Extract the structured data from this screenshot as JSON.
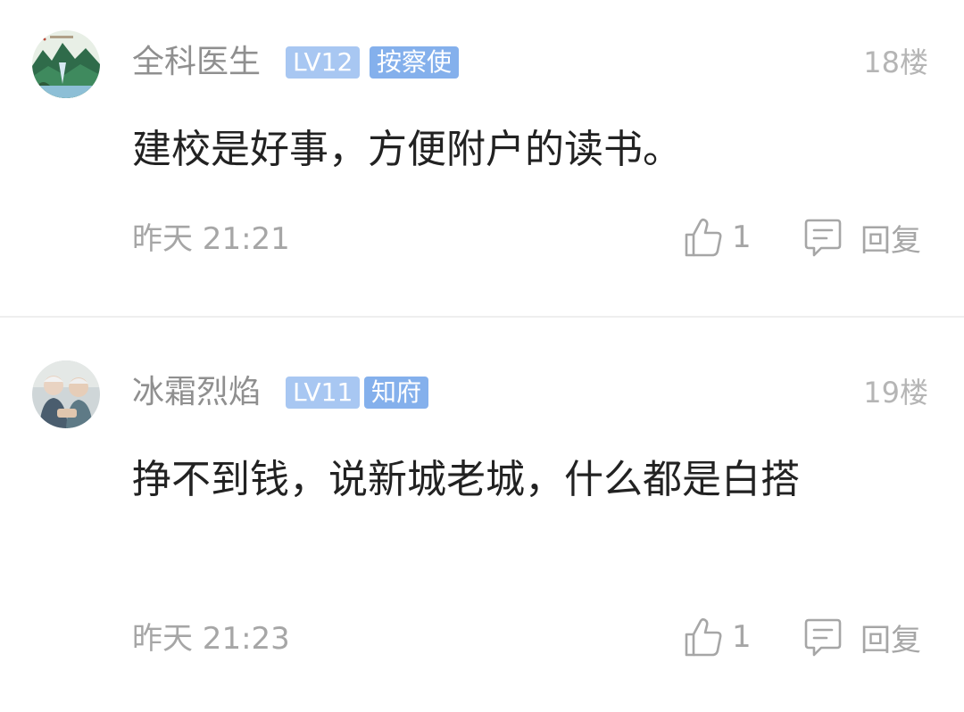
{
  "comments": [
    {
      "username": "全科医生",
      "level": "LV12",
      "title": "按察使",
      "floor": "18楼",
      "content": "建校是好事，方便附户的读书。",
      "time": "昨天 21:21",
      "likes": "1",
      "reply_label": "回复",
      "avatar_icon": "landscape-painting-avatar"
    },
    {
      "username": "冰霜烈焰",
      "level": "LV11",
      "title": "知府",
      "floor": "19楼",
      "content": "挣不到钱，说新城老城，什么都是白搭",
      "time": "昨天 21:23",
      "likes": "1",
      "reply_label": "回复",
      "avatar_icon": "elderly-couple-photo-avatar"
    }
  ],
  "colors": {
    "level_badge": "#a8c7f2",
    "title_badge": "#84b0ec",
    "username": "#8f8f8f",
    "meta": "#a6a6a6",
    "content": "#222222"
  }
}
